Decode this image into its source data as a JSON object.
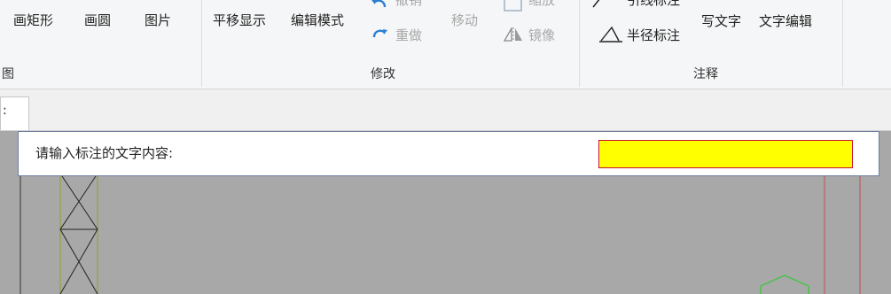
{
  "ribbon": {
    "draw_group": {
      "buttons": [
        "画矩形",
        "画圆",
        "图片"
      ],
      "label": "图"
    },
    "modify_group": {
      "pan_label": "平移显示",
      "edit_mode_label": "编辑模式",
      "undo_label": "撤销",
      "redo_label": "重做",
      "move_label": "移动",
      "scale_label": "缩放",
      "mirror_label": "镜像",
      "label": "修改"
    },
    "annotate_group": {
      "leader_label": "引线标注",
      "radius_label": "半径标注",
      "write_text_label": "写文字",
      "text_edit_label": "文字编辑",
      "label": "注释"
    }
  },
  "tab": {
    "label": ":"
  },
  "prompt": {
    "label": "请输入标注的文字内容:",
    "value": "",
    "input_color": "#ffff00",
    "input_border_color": "#c8102e"
  },
  "colors": {
    "canvas_bg": "#a8a8a8",
    "tower_color": "#9aa040",
    "circle_color": "#2ecc2e",
    "red_line": "#c0504d"
  }
}
